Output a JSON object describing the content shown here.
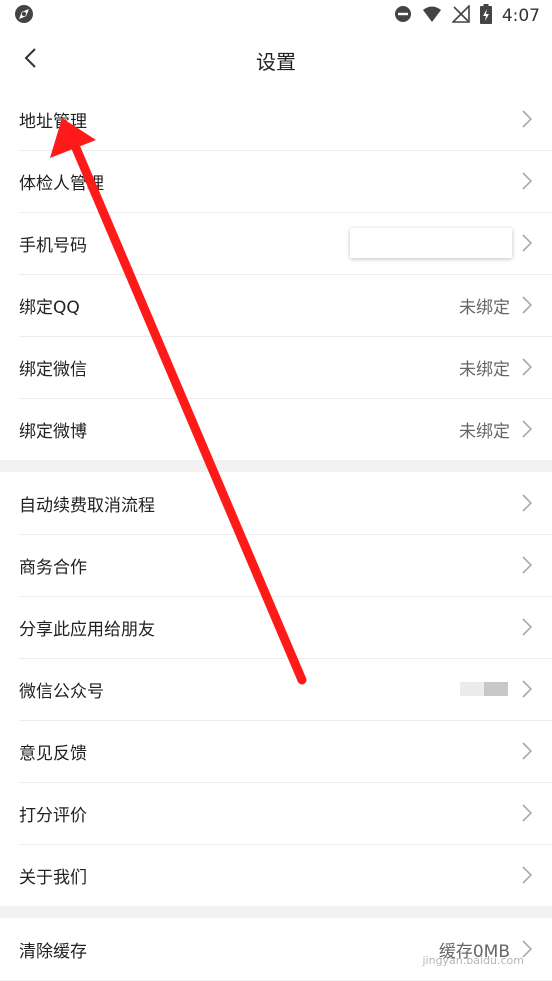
{
  "status_bar": {
    "time": "4:07",
    "left_icon": "app-logo-icon",
    "icons": [
      "dnd-icon",
      "wifi-icon",
      "no-signal-icon",
      "battery-charging-icon"
    ]
  },
  "header": {
    "title": "设置",
    "back_icon": "chevron-left-icon"
  },
  "group1": [
    {
      "label": "地址管理",
      "value": ""
    },
    {
      "label": "体检人管理",
      "value": ""
    },
    {
      "label": "手机号码",
      "value": ""
    },
    {
      "label": "绑定QQ",
      "value": "未绑定"
    },
    {
      "label": "绑定微信",
      "value": "未绑定"
    },
    {
      "label": "绑定微博",
      "value": "未绑定"
    }
  ],
  "group2": [
    {
      "label": "自动续费取消流程"
    },
    {
      "label": "商务合作"
    },
    {
      "label": "分享此应用给朋友"
    },
    {
      "label": "微信公众号"
    },
    {
      "label": "意见反馈"
    },
    {
      "label": "打分评价"
    },
    {
      "label": "关于我们"
    }
  ],
  "group3": [
    {
      "label": "清除缓存",
      "value": "缓存0MB"
    }
  ],
  "watermark": "jingyan.baidu.com",
  "colors": {
    "annotation_arrow": "#ff1a1a",
    "background": "#f2f2f2"
  }
}
